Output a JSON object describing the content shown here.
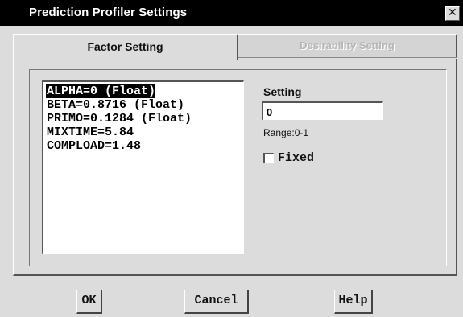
{
  "window": {
    "title": "Prediction Profiler Settings",
    "close_icon": "close-icon"
  },
  "tabs": [
    {
      "label": "Factor Setting",
      "active": true
    },
    {
      "label": "Desirability Setting",
      "active": false
    }
  ],
  "factor_list": {
    "items": [
      {
        "label": "ALPHA=0 (Float)",
        "selected": true
      },
      {
        "label": "BETA=0.8716 (Float)",
        "selected": false
      },
      {
        "label": "PRIMO=0.1284 (Float)",
        "selected": false
      },
      {
        "label": "MIXTIME=5.84",
        "selected": false
      },
      {
        "label": "COMPLOAD=1.48",
        "selected": false
      }
    ]
  },
  "setting": {
    "label": "Setting",
    "value": "0",
    "range": "Range:0-1",
    "fixed_label": "Fixed",
    "fixed_checked": false
  },
  "buttons": {
    "ok": "OK",
    "cancel": "Cancel",
    "help": "Help"
  },
  "colors": {
    "titlebar": "#000000",
    "dialog_bg": "#dcdcdc",
    "selection": "#000000"
  }
}
